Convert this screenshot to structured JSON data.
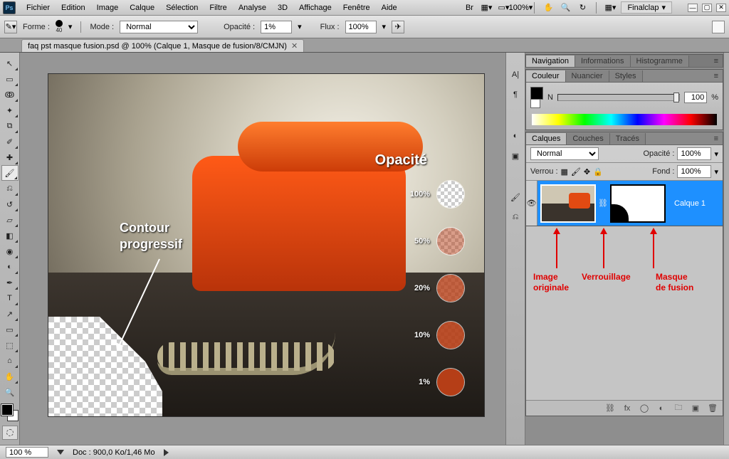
{
  "app": {
    "logo_text": "Ps",
    "workspace": "Finalclap"
  },
  "menu": [
    "Fichier",
    "Edition",
    "Image",
    "Calque",
    "Sélection",
    "Filtre",
    "Analyse",
    "3D",
    "Affichage",
    "Fenêtre",
    "Aide"
  ],
  "topbar_zoom": "100%",
  "options": {
    "forme_label": "Forme :",
    "brush_size": "40",
    "mode_label": "Mode :",
    "mode_value": "Normal",
    "opacite_label": "Opacité :",
    "opacite_value": "1%",
    "flux_label": "Flux :",
    "flux_value": "100%"
  },
  "doc_tab": "faq pst masque fusion.psd @ 100% (Calque 1, Masque de fusion/8/CMJN)",
  "canvas_annotations": {
    "contour": "Contour\nprogressif",
    "opacite_title": "Opacité",
    "opacities": [
      "100%",
      "50%",
      "20%",
      "10%",
      "1%"
    ]
  },
  "panels": {
    "nav_tabs": [
      "Navigation",
      "Informations",
      "Histogramme"
    ],
    "color_tabs": [
      "Couleur",
      "Nuancier",
      "Styles"
    ],
    "color": {
      "channel": "N",
      "value": "100",
      "unit": "%"
    },
    "layers_tabs": [
      "Calques",
      "Couches",
      "Tracés"
    ],
    "layers": {
      "blend_mode": "Normal",
      "opacite_label": "Opacité :",
      "opacite_value": "100%",
      "verrou_label": "Verrou :",
      "fond_label": "Fond :",
      "fond_value": "100%",
      "layer_name": "Calque 1"
    }
  },
  "red_labels": {
    "img": "Image\noriginale",
    "lock": "Verrouillage",
    "mask": "Masque\nde fusion"
  },
  "status": {
    "zoom": "100 %",
    "doc": "Doc : 900,0 Ko/1,46 Mo"
  }
}
